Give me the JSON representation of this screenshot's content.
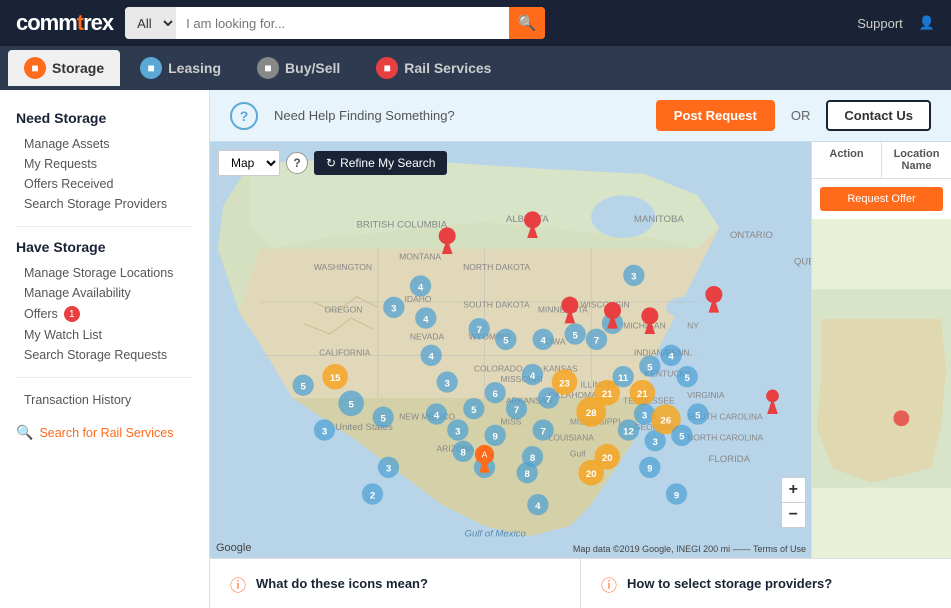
{
  "header": {
    "logo_text": "commtrex",
    "search_select_default": "All",
    "search_placeholder": "I am looking for...",
    "nav_support": "Support",
    "user_icon": "👤"
  },
  "nav": {
    "tabs": [
      {
        "id": "storage",
        "label": "Storage",
        "icon": "🏭",
        "active": true
      },
      {
        "id": "leasing",
        "label": "Leasing",
        "icon": "🚂",
        "active": false
      },
      {
        "id": "buysell",
        "label": "Buy/Sell",
        "icon": "💱",
        "active": false
      },
      {
        "id": "rail",
        "label": "Rail Services",
        "icon": "🔥",
        "active": false
      }
    ]
  },
  "sidebar": {
    "need_storage_title": "Need Storage",
    "manage_assets": "Manage Assets",
    "my_requests": "My Requests",
    "offers_received": "Offers Received",
    "offers_badge": "1",
    "search_storage_providers": "Search Storage Providers",
    "have_storage_title": "Have Storage",
    "manage_locations": "Manage Storage Locations",
    "manage_availability": "Manage Availability",
    "offers": "Offers",
    "my_watch_list": "My Watch List",
    "search_storage_requests": "Search Storage Requests",
    "transaction_history": "Transaction History",
    "search_rail_services": "Search for Rail Services"
  },
  "topbar": {
    "help_icon": "?",
    "help_text": "Need Help Finding Something?",
    "post_button": "Post Request",
    "or_text": "OR",
    "contact_button": "Contact Us"
  },
  "map": {
    "view_select": "Map",
    "refine_button": "Refine My Search",
    "panel": {
      "action_col": "Action",
      "location_col": "Location Name",
      "request_offer_btn": "Request Offer"
    },
    "google_attr": "Google",
    "map_data_attr": "Map data ©2019 Google, INEGI  200 mi ——  Terms of Use"
  },
  "bottom": {
    "card1_title": "What do these icons mean?",
    "card2_title": "How to select storage providers?"
  }
}
